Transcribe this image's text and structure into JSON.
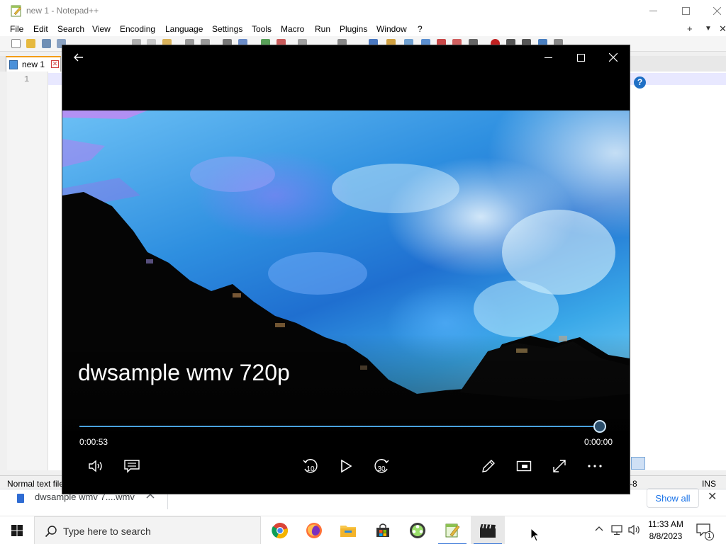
{
  "notepad": {
    "title": "new 1 - Notepad++",
    "menus": [
      "File",
      "Edit",
      "Search",
      "View",
      "Encoding",
      "Language",
      "Settings",
      "Tools",
      "Macro",
      "Run",
      "Plugins",
      "Window",
      "?"
    ],
    "right_controls": {
      "add": "+",
      "dropdown": "▼",
      "close": "✕"
    },
    "tab": {
      "label": "new 1",
      "close": "✕"
    },
    "line_number": "1",
    "help": "?",
    "status": {
      "left": "Normal text file",
      "encoding": "-8",
      "mode": "INS"
    }
  },
  "download_bar": {
    "filename": "dwsample wmv 7....wmv",
    "show_all": "Show all",
    "close": "✕"
  },
  "player": {
    "video_title": "dwsample wmv 720p",
    "elapsed": "0:00:53",
    "remaining": "0:00:00",
    "progress": 0.99,
    "skip_back": "10",
    "skip_forward": "30"
  },
  "taskbar": {
    "search_placeholder": "Type here to search",
    "time": "11:33 AM",
    "date": "8/8/2023",
    "notification_count": "1",
    "apps": [
      "chrome-icon",
      "firefox-icon",
      "file-explorer-icon",
      "store-icon",
      "media-player-icon",
      "notepadpp-icon",
      "movies-tv-icon"
    ]
  },
  "colors": {
    "accent_blue": "#4aa3df",
    "taskbar_highlight": "#3b78d8",
    "player_bg": "#000000"
  }
}
